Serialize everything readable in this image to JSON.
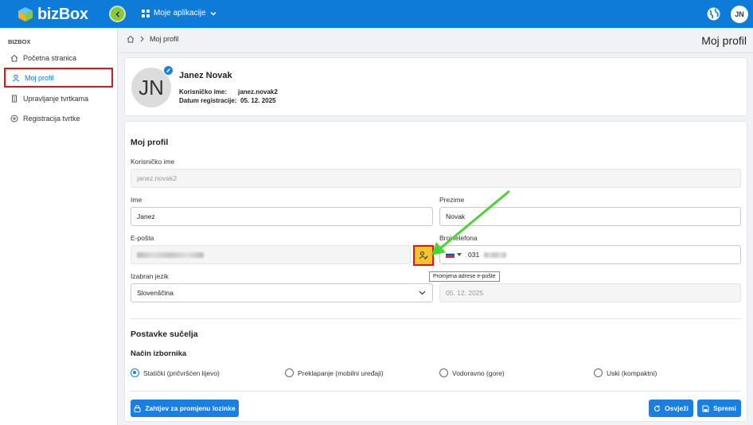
{
  "app": {
    "brand": "bizBox",
    "apps_label": "Moje aplikacije",
    "user_initials": "JN"
  },
  "sidebar": {
    "section_title": "BIZBOX",
    "items": [
      {
        "label": "Početna stranica",
        "icon": "home-icon"
      },
      {
        "label": "Moj profil",
        "icon": "user-icon"
      },
      {
        "label": "Upravljanje tvrtkama",
        "icon": "building-icon"
      },
      {
        "label": "Registracija tvrtke",
        "icon": "plus-circle-icon"
      }
    ]
  },
  "breadcrumb": {
    "current": "Moj profil"
  },
  "page_title": "Moj profil",
  "profile": {
    "initials": "JN",
    "name": "Janez Novak",
    "username_label": "Korisničko ime:",
    "username": "janez.novak2",
    "registered_label": "Datum registracije:",
    "registered": "05. 12. 2025"
  },
  "form": {
    "section_title": "Moj profil",
    "username_label": "Korisničko ime",
    "username_value": "janez.novak2",
    "first_name_label": "Ime",
    "first_name_value": "Janez",
    "last_name_label": "Prezime",
    "last_name_value": "Novak",
    "email_label": "E-pošta",
    "phone_label": "Broj telefona",
    "phone_prefix": "031",
    "email_change_tooltip": "Promjena adrese e-pošte",
    "language_label": "Izabran jezik",
    "language_value": "Slovenščina",
    "date_value": "05. 12. 2025"
  },
  "ui_settings": {
    "title": "Postavke sučelja",
    "menu_mode_label": "Način izbornika",
    "options": [
      "Statički (pričvršćen lijevo)",
      "Preklapanje (mobilni uređaji)",
      "Vodoravno (gore)",
      "Uski (kompaktni)"
    ],
    "selected_index": 0
  },
  "buttons": {
    "password_change": "Zahtjev za promjenu lozinke",
    "refresh": "Osvježi",
    "save": "Spremi"
  },
  "colors": {
    "primary": "#1a7fe0",
    "topbar": "#0f7bd9",
    "highlight_border": "#e0141e",
    "annotation_arrow": "#4cd435",
    "highlight_fill": "#f4c430"
  }
}
